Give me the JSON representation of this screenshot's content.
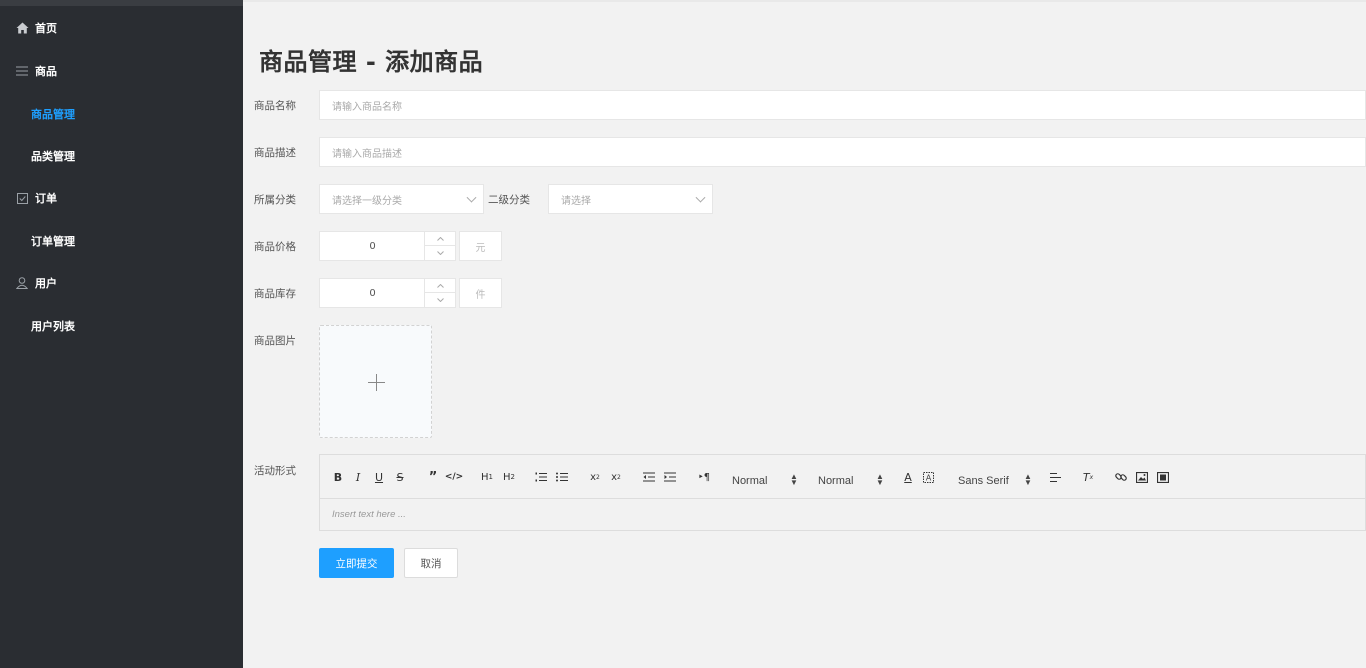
{
  "sidebar": {
    "items": [
      {
        "label": "首页",
        "icon": "home-icon"
      },
      {
        "label": "商品",
        "icon": "list-icon"
      },
      {
        "label": "商品管理"
      },
      {
        "label": "品类管理"
      },
      {
        "label": "订单",
        "icon": "checkbox-icon"
      },
      {
        "label": "订单管理"
      },
      {
        "label": "用户",
        "icon": "user-icon"
      },
      {
        "label": "用户列表"
      }
    ],
    "active_color": "#1e9fff",
    "background": "#2a2d32"
  },
  "page": {
    "title": "商品管理 - 添加商品"
  },
  "form": {
    "name": {
      "label": "商品名称",
      "placeholder": "请输入商品名称"
    },
    "desc": {
      "label": "商品描述",
      "placeholder": "请输入商品描述"
    },
    "category": {
      "label": "所属分类",
      "placeholder": "请选择一级分类",
      "sub_label": "二级分类",
      "sub_placeholder": "请选择"
    },
    "price": {
      "label": "商品价格",
      "value": "0",
      "unit": "元"
    },
    "stock": {
      "label": "商品库存",
      "value": "0",
      "unit": "件"
    },
    "image": {
      "label": "商品图片"
    },
    "activity": {
      "label": "活动形式"
    }
  },
  "editor": {
    "header_value": "Normal",
    "size_value": "Normal",
    "font_value": "Sans Serif",
    "placeholder": "Insert text here ..."
  },
  "buttons": {
    "submit": "立即提交",
    "cancel": "取消"
  },
  "colors": {
    "primary": "#1e9fff",
    "page_bg": "#f2f2f2"
  }
}
